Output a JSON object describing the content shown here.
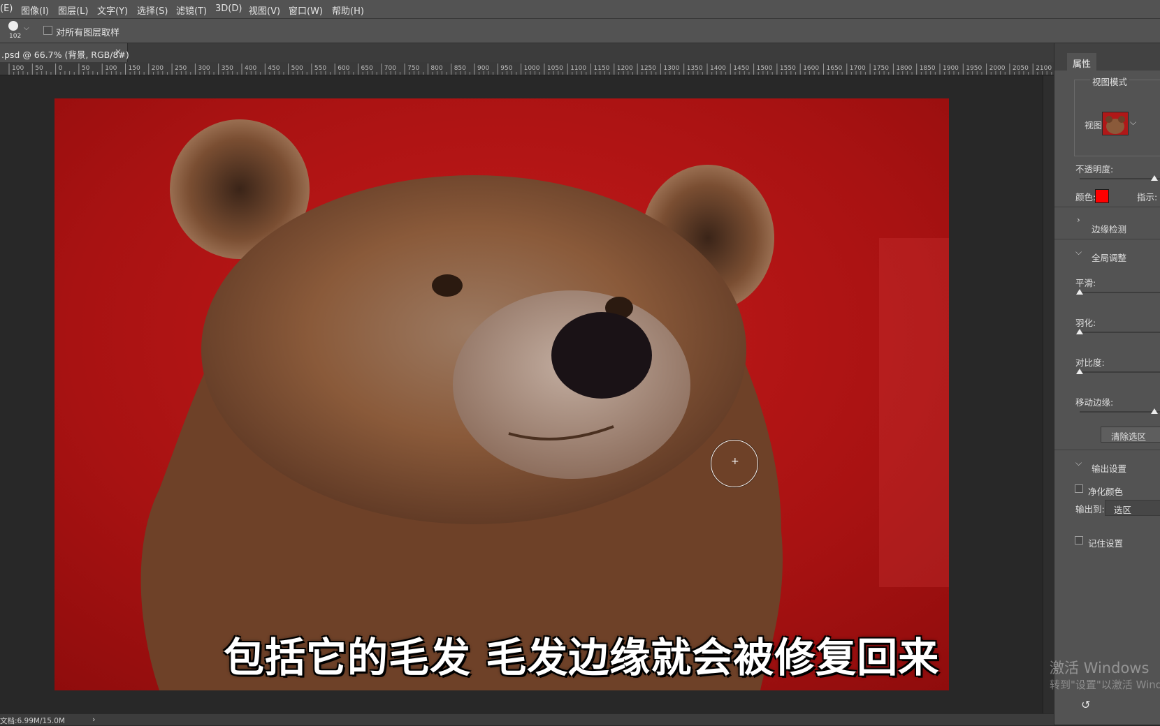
{
  "menubar": {
    "items": [
      "(E)",
      "图像(I)",
      "图层(L)",
      "文字(Y)",
      "选择(S)",
      "滤镜(T)",
      "3D(D)",
      "视图(V)",
      "窗口(W)",
      "帮助(H)"
    ]
  },
  "options": {
    "brush_size": "102",
    "sample_all_layers_label": "对所有图层取样",
    "sample_all_layers_checked": false
  },
  "document_tab": {
    "label": ".psd @ 66.7% (背景, RGB/8#)",
    "close": "×"
  },
  "ruler": {
    "labels": [
      "100",
      "50",
      "0",
      "50",
      "100",
      "150",
      "200",
      "250",
      "300",
      "350",
      "400",
      "450",
      "500",
      "550",
      "600",
      "650",
      "700",
      "750",
      "800",
      "850",
      "900",
      "950",
      "1000",
      "1050",
      "1100",
      "1150",
      "1200",
      "1250",
      "1300",
      "1350",
      "1400",
      "1450",
      "1500",
      "1550",
      "1600",
      "1650",
      "1700",
      "1750",
      "1800",
      "1850",
      "1900",
      "1950",
      "2000",
      "2050",
      "2100"
    ]
  },
  "canvas": {
    "subtitle": "包括它的毛发  毛发边缘就会被修复回来",
    "overlay_color": "#b01414",
    "brush_cursor_symbol": "+"
  },
  "statusbar": {
    "doc_info": "文档:6.99M/15.0M",
    "arrow": "›"
  },
  "panel": {
    "tab_label": "属性",
    "view_mode": {
      "section_label": "视图模式",
      "view_label": "视图:"
    },
    "opacity_label": "不透明度:",
    "color_label": "颜色:",
    "color_value": "#ff0000",
    "indicate_label": "指示:",
    "edge_detection": {
      "label": "边缘检测",
      "expanded": false
    },
    "global_refine": {
      "label": "全局调整",
      "expanded": true,
      "smooth_label": "平滑:",
      "feather_label": "羽化:",
      "contrast_label": "对比度:",
      "shift_edge_label": "移动边缘:",
      "clear_selection_label": "清除选区"
    },
    "output_settings": {
      "label": "输出设置",
      "expanded": true,
      "decontaminate_label": "净化颜色",
      "output_to_label": "输出到:",
      "output_to_value": "选区",
      "remember_label": "记住设置"
    },
    "undo_icon": "undo-icon"
  },
  "watermark": {
    "line1": "激活 Windows",
    "line2": "转到\"设置\"以激活 Wind"
  }
}
